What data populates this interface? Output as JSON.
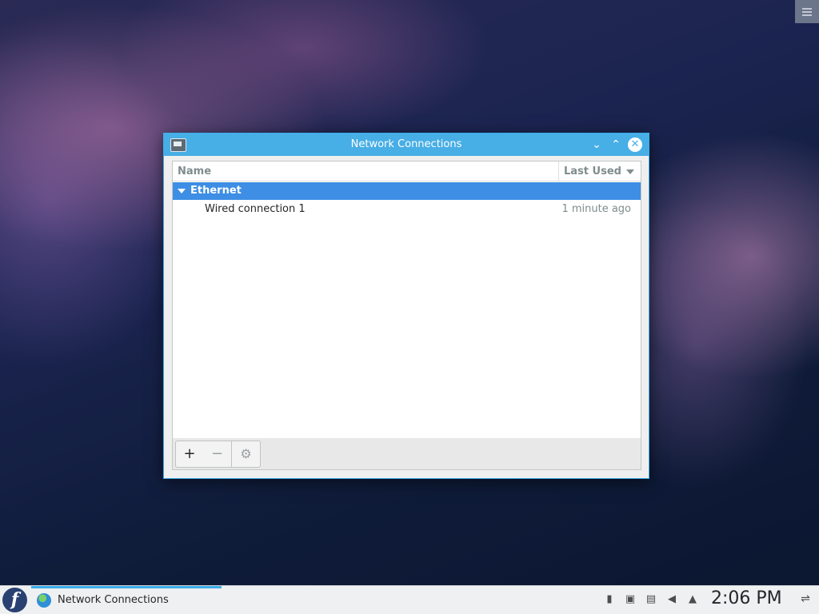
{
  "window": {
    "title": "Network Connections",
    "columns": {
      "name": "Name",
      "last_used": "Last Used"
    },
    "groups": [
      {
        "label": "Ethernet",
        "connections": [
          {
            "name": "Wired connection 1",
            "last_used": "1 minute ago"
          }
        ]
      }
    ],
    "toolbar": {
      "add": "+",
      "remove": "−",
      "settings": "⚙"
    }
  },
  "taskbar": {
    "launcher": "f",
    "tasks": [
      {
        "label": "Network Connections",
        "icon": "network-globe-icon"
      }
    ],
    "tray_icons": [
      "usb-icon",
      "network-icon",
      "clipboard-icon",
      "volume-icon",
      "tray-expand-icon"
    ],
    "clock": "2:06 PM"
  },
  "colors": {
    "titlebar": "#47aee6",
    "selection": "#3d8ee4",
    "accent": "#3daee9"
  }
}
